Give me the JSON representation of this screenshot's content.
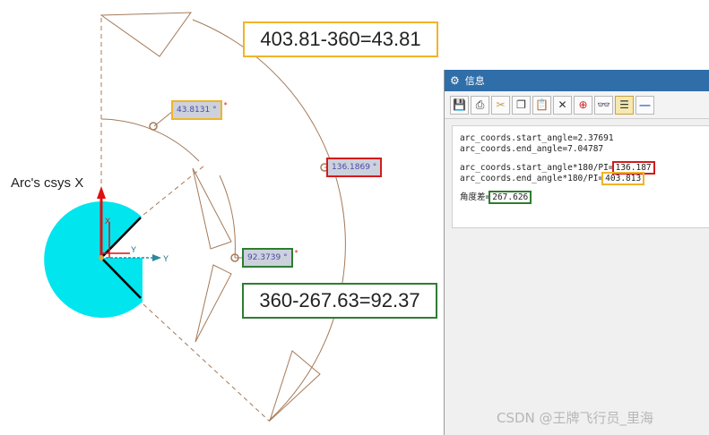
{
  "window": {
    "title": "信息",
    "toolbar_icons": [
      "save-icon",
      "print-icon",
      "cut-icon",
      "copy-icon",
      "paste-icon",
      "delete-icon",
      "locate-icon",
      "find-icon",
      "wrap-icon",
      "minimize-icon"
    ],
    "lines": {
      "start_angle": "arc_coords.start_angle=2.37691",
      "end_angle": "arc_coords.end_angle=7.04787",
      "start_deg_prefix": "arc_coords.start_angle*180/PI=",
      "start_deg_value": "136.187",
      "end_deg_prefix": "arc_coords.end_angle*180/PI=",
      "end_deg_value": "403.813",
      "angle_diff_prefix": "角度差=",
      "angle_diff_value": "267.626"
    }
  },
  "cad": {
    "csys_label": "Arc's csys X",
    "axis_x": "X",
    "axis_y": "Y",
    "axis_y_end": "Y",
    "dim_top": "43.8131 °",
    "dim_right": "136.1869 °",
    "dim_bottom": "92.3739 °",
    "dim_star": "*"
  },
  "callouts": {
    "top": "403.81-360=43.81",
    "bottom": "360-267.63=92.37"
  },
  "colors": {
    "circle_fill": "#00e5ee",
    "arc_line": "#a57a58",
    "highlight_red": "#d21c1c",
    "highlight_orange": "#f0b428",
    "highlight_green": "#2e7d32",
    "title_blue": "#2f6ea8"
  },
  "watermark": "CSDN @王牌飞行员_里海"
}
